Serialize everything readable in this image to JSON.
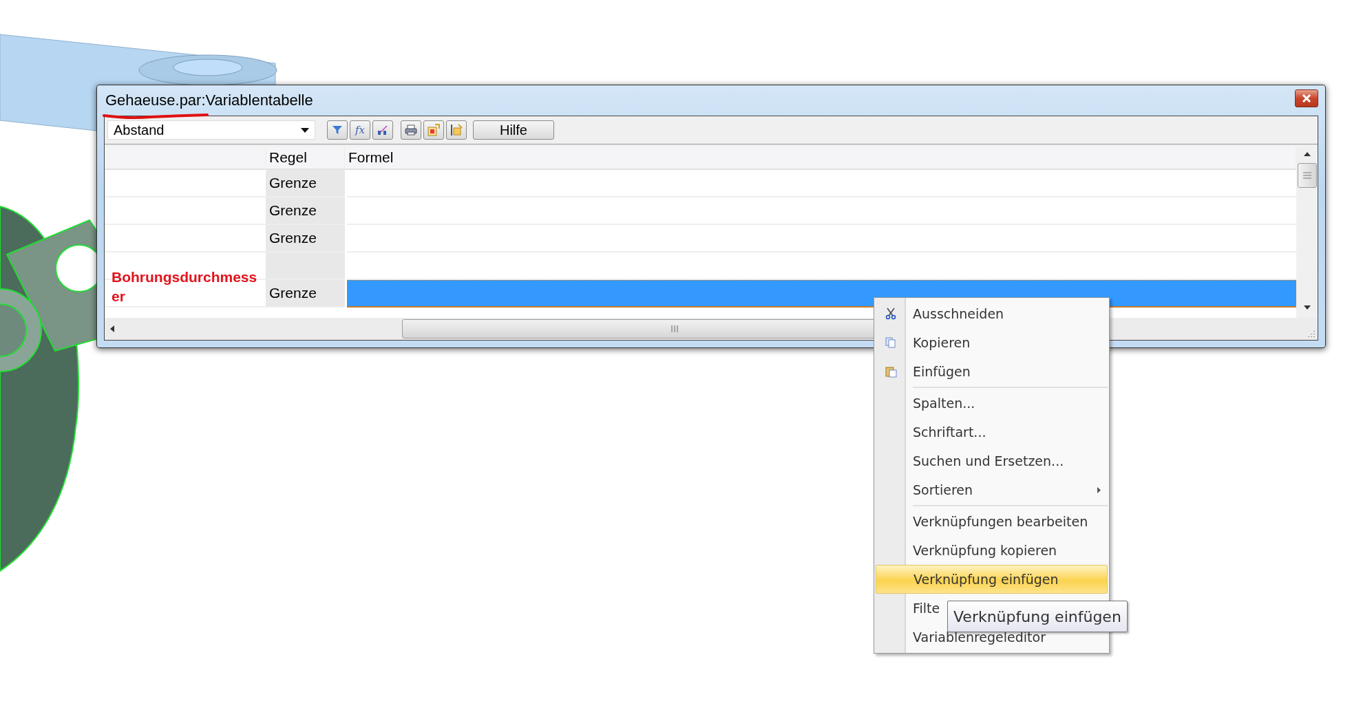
{
  "window": {
    "title_file": "Gehaeuse.par",
    "title_rest": ":Variablentabelle"
  },
  "toolbar": {
    "dropdown_value": "Abstand",
    "buttons": [
      {
        "kind": "filter"
      },
      {
        "kind": "formula",
        "label": "fx"
      },
      {
        "kind": "sort"
      },
      {
        "kind": "print"
      },
      {
        "kind": "export"
      },
      {
        "kind": "import"
      }
    ],
    "help_label": "Hilfe"
  },
  "table": {
    "columns": [
      {
        "label": "Regel"
      },
      {
        "label": "Formel"
      }
    ],
    "rows": [
      {
        "rule": "Grenze",
        "selected": false
      },
      {
        "rule": "Grenze",
        "selected": false
      },
      {
        "rule": "Grenze",
        "selected": false
      },
      {
        "selected": false
      },
      {
        "name": "Bohrungsdurchmesser",
        "rule": "Grenze",
        "selected": true
      }
    ]
  },
  "context_menu": {
    "items": [
      {
        "label": "Ausschneiden",
        "kind": "cut",
        "separator_before": false,
        "submenu": false,
        "selected": false
      },
      {
        "label": "Kopieren",
        "kind": "copy",
        "separator_before": false,
        "submenu": false,
        "selected": false
      },
      {
        "label": "Einfügen",
        "kind": "paste",
        "separator_before": false,
        "submenu": false,
        "selected": false
      },
      {
        "label": "Spalten...",
        "separator_before": true,
        "submenu": false,
        "selected": false
      },
      {
        "label": "Schriftart...",
        "separator_before": false,
        "submenu": false,
        "selected": false
      },
      {
        "label": "Suchen und Ersetzen...",
        "separator_before": false,
        "submenu": false,
        "selected": false
      },
      {
        "label": "Sortieren",
        "separator_before": false,
        "submenu": true,
        "selected": false
      },
      {
        "label": "Verknüpfungen bearbeiten",
        "separator_before": true,
        "submenu": false,
        "selected": false
      },
      {
        "label": "Verknüpfung kopieren",
        "separator_before": false,
        "submenu": false,
        "selected": false
      },
      {
        "label": "Verknüpfung einfügen",
        "separator_before": false,
        "submenu": false,
        "selected": true
      },
      {
        "label": "Filte",
        "separator_before": false,
        "submenu": false,
        "selected": false
      },
      {
        "label": "Variablenregeleditor",
        "separator_before": false,
        "submenu": false,
        "selected": false
      }
    ]
  },
  "tooltip": {
    "text": "Verknüpfung einfügen"
  }
}
